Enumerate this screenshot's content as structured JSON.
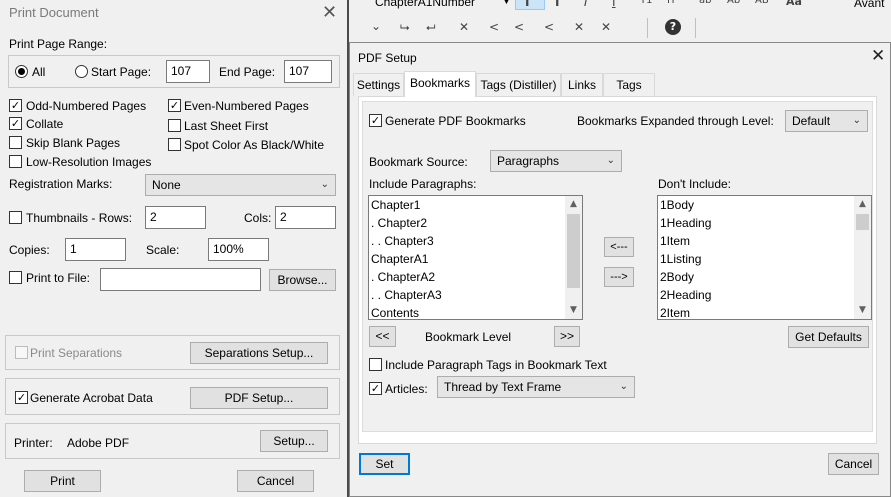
{
  "print_dialog": {
    "title": "Print Document",
    "page_range": {
      "label": "Print Page Range:",
      "all_label": "All",
      "start_label": "Start Page:",
      "start_value": "107",
      "end_label": "End Page:",
      "end_value": "107"
    },
    "options": {
      "odd": "Odd-Numbered Pages",
      "even": "Even-Numbered Pages",
      "collate": "Collate",
      "last_sheet": "Last Sheet First",
      "skip_blank": "Skip Blank Pages",
      "spot_color": "Spot Color As Black/White",
      "low_res": "Low-Resolution Images"
    },
    "registration": {
      "label": "Registration Marks:",
      "value": "None"
    },
    "thumbnails": {
      "label": "Thumbnails - Rows:",
      "rows": "2",
      "cols_label": "Cols:",
      "cols": "2"
    },
    "copies": {
      "label": "Copies:",
      "value": "1",
      "scale_label": "Scale:",
      "scale": "100%"
    },
    "print_to_file": {
      "label": "Print to File:",
      "browse": "Browse..."
    },
    "separations": {
      "label": "Print Separations",
      "button": "Separations Setup..."
    },
    "acrobat": {
      "label": "Generate Acrobat Data",
      "button": "PDF Setup..."
    },
    "printer": {
      "label": "Printer:",
      "value": "Adobe PDF",
      "button": "Setup..."
    },
    "print_button": "Print",
    "cancel_button": "Cancel"
  },
  "toolbar": {
    "style_value": "ChapterA1Number",
    "right_text": "Avant",
    "format_glyphs": [
      "I",
      "I",
      "I",
      "I",
      "T1",
      "IT",
      "ab",
      "Ab",
      "AB",
      "Aa"
    ]
  },
  "pdf_setup": {
    "title": "PDF Setup",
    "tabs": [
      "Settings",
      "Bookmarks",
      "Tags (Distiller)",
      "Links",
      "Tags"
    ],
    "generate_label": "Generate PDF Bookmarks",
    "expanded_label": "Bookmarks Expanded through Level:",
    "expanded_value": "Default",
    "source_label": "Bookmark Source:",
    "source_value": "Paragraphs",
    "include_label": "Include Paragraphs:",
    "include_items": [
      "Chapter1",
      ". Chapter2",
      ". . Chapter3",
      "ChapterA1",
      ". ChapterA2",
      ". . ChapterA3",
      "Contents"
    ],
    "exclude_label": "Don't Include:",
    "exclude_items": [
      "1Body",
      "1Heading",
      "1Item",
      "1Listing",
      "2Body",
      "2Heading",
      "2Item"
    ],
    "move_left": "<---",
    "move_right": "--->",
    "level_left": "<<",
    "level_label": "Bookmark Level",
    "level_right": ">>",
    "get_defaults": "Get Defaults",
    "include_tags_label": "Include Paragraph Tags in Bookmark Text",
    "articles_label": "Articles:",
    "articles_value": "Thread by Text Frame",
    "set_button": "Set",
    "cancel_button": "Cancel"
  }
}
